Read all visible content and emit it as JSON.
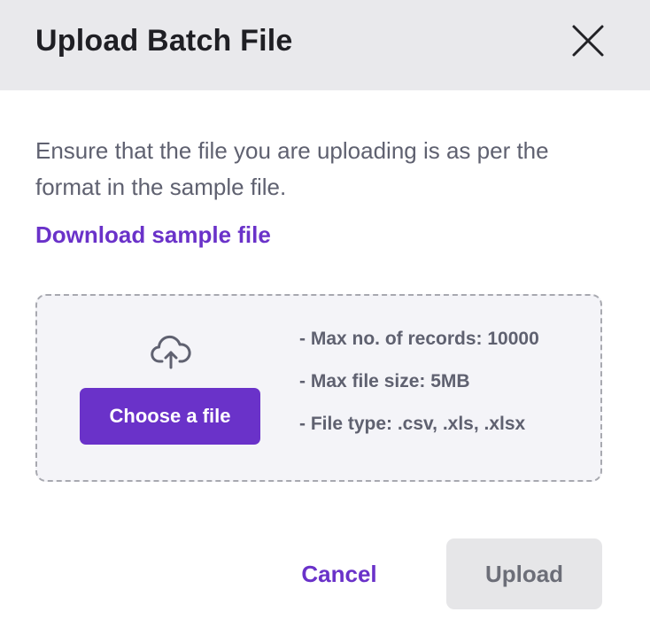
{
  "dialog": {
    "title": "Upload Batch File",
    "close_icon": "close-icon"
  },
  "body": {
    "description": "Ensure that the file you are uploading is as per the format in the sample file.",
    "download_link": "Download sample file"
  },
  "dropzone": {
    "icon": "cloud-upload-icon",
    "choose_button": "Choose a file",
    "rules": [
      "- Max no. of records: 10000",
      "- Max file size: 5MB",
      "- File type: .csv, .xls, .xlsx"
    ]
  },
  "footer": {
    "cancel_label": "Cancel",
    "upload_label": "Upload"
  },
  "colors": {
    "accent": "#6a32c9",
    "header_bg": "#e9e9ec",
    "dropzone_bg": "#f4f4f8",
    "disabled_button_bg": "#e6e6e8"
  }
}
